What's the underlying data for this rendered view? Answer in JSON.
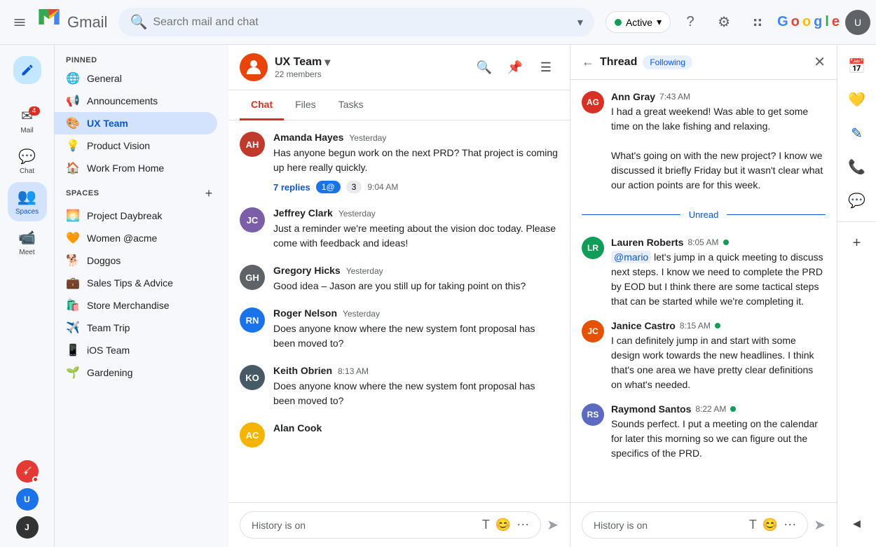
{
  "topbar": {
    "search_placeholder": "Search mail and chat",
    "status_label": "Active",
    "status_dropdown": "▾",
    "google_text": "Google"
  },
  "sidebar": {
    "pinned_label": "PINNED",
    "spaces_label": "SPACES",
    "pinned_items": [
      {
        "id": "general",
        "label": "General",
        "icon": "🌐"
      },
      {
        "id": "announcements",
        "label": "Announcements",
        "icon": "📢"
      },
      {
        "id": "ux-team",
        "label": "UX Team",
        "icon": "🎨",
        "active": true
      },
      {
        "id": "product-vision",
        "label": "Product Vision",
        "icon": "💡"
      },
      {
        "id": "work-from-home",
        "label": "Work From Home",
        "icon": "🏠"
      }
    ],
    "spaces_items": [
      {
        "id": "project-daybreak",
        "label": "Project Daybreak",
        "icon": "🌅"
      },
      {
        "id": "women-acme",
        "label": "Women @acme",
        "icon": "🧡"
      },
      {
        "id": "doggos",
        "label": "Doggos",
        "icon": "🐕"
      },
      {
        "id": "sales-tips",
        "label": "Sales Tips & Advice",
        "icon": "💼"
      },
      {
        "id": "store-merch",
        "label": "Store Merchandise",
        "icon": "🛍️"
      },
      {
        "id": "team-trip",
        "label": "Team Trip",
        "icon": "✈️"
      },
      {
        "id": "ios-team",
        "label": "iOS Team",
        "icon": "📱"
      },
      {
        "id": "gardening",
        "label": "Gardening",
        "icon": "🌱"
      }
    ]
  },
  "chat_panel": {
    "team_name": "UX Team",
    "member_count": "22 members",
    "tabs": [
      {
        "id": "chat",
        "label": "Chat",
        "active": true
      },
      {
        "id": "files",
        "label": "Files",
        "active": false
      },
      {
        "id": "tasks",
        "label": "Tasks",
        "active": false
      }
    ],
    "messages": [
      {
        "id": "msg1",
        "name": "Amanda Hayes",
        "time": "Yesterday",
        "text": "Has anyone begun work on the next PRD? That project is coming up here really quickly.",
        "reply_count": "7 replies",
        "reaction_at": "1@",
        "reaction_num": "3",
        "timestamp": "9:04 AM",
        "avatar_color": "#c0392b",
        "initials": "AH"
      },
      {
        "id": "msg2",
        "name": "Jeffrey Clark",
        "time": "Yesterday",
        "text": "Just a reminder we're meeting about the vision doc today. Please come with feedback and ideas!",
        "avatar_color": "#7b5ea7",
        "initials": "JC"
      },
      {
        "id": "msg3",
        "name": "Gregory Hicks",
        "time": "Yesterday",
        "text": "Good idea – Jason are you still up for taking point on this?",
        "avatar_color": "#5f6368",
        "initials": "GH"
      },
      {
        "id": "msg4",
        "name": "Roger Nelson",
        "time": "Yesterday",
        "text": "Does anyone know where the new system font proposal has been moved to?",
        "avatar_color": "#1a73e8",
        "initials": "RN"
      },
      {
        "id": "msg5",
        "name": "Keith Obrien",
        "time": "8:13 AM",
        "text": "Does anyone know where the new system font proposal has been moved to?",
        "avatar_color": "#455a64",
        "initials": "KO"
      },
      {
        "id": "msg6",
        "name": "Alan Cook",
        "time": "",
        "text": "",
        "avatar_color": "#f4b400",
        "initials": "AC"
      }
    ],
    "input_placeholder": "History is on"
  },
  "thread_panel": {
    "title": "Thread",
    "following_label": "Following",
    "messages": [
      {
        "id": "t1",
        "name": "Ann Gray",
        "time": "7:43 AM",
        "text": "I had a great weekend! Was able to get some time on the lake fishing and relaxing.\n\nWhat's going on with the new project? I know we discussed it briefly Friday but it wasn't clear what our action points are for this week.",
        "avatar_color": "#d93025",
        "initials": "AG",
        "online": false
      },
      {
        "id": "unread",
        "type": "divider",
        "label": "Unread"
      },
      {
        "id": "t2",
        "name": "Lauren Roberts",
        "time": "8:05 AM",
        "text": "@mario let's jump in a quick meeting to discuss next steps. I know we need to complete the PRD by EOD but I think there are some tactical steps that can be started while we're completing it.",
        "avatar_color": "#0f9d58",
        "initials": "LR",
        "online": true,
        "mention": "@mario"
      },
      {
        "id": "t3",
        "name": "Janice Castro",
        "time": "8:15 AM",
        "text": "I can definitely jump in and start with some design work towards the new headlines. I think that's one area we have pretty clear definitions on what's needed.",
        "avatar_color": "#e65100",
        "initials": "JC",
        "online": true
      },
      {
        "id": "t4",
        "name": "Raymond Santos",
        "time": "8:22 AM",
        "text": "Sounds perfect. I put a meeting on the calendar for later this morning so we can figure out the specifics of the PRD.",
        "avatar_color": "#5c6bc0",
        "initials": "RS",
        "online": true
      }
    ],
    "input_placeholder": "History is on"
  },
  "nav": {
    "mail_label": "Mail",
    "chat_label": "Chat",
    "spaces_label": "Spaces",
    "meet_label": "Meet",
    "mail_badge": "4"
  },
  "right_rail": {
    "icons": [
      "📅",
      "🔔",
      "🎨",
      "📞",
      "✏️",
      "+"
    ]
  }
}
